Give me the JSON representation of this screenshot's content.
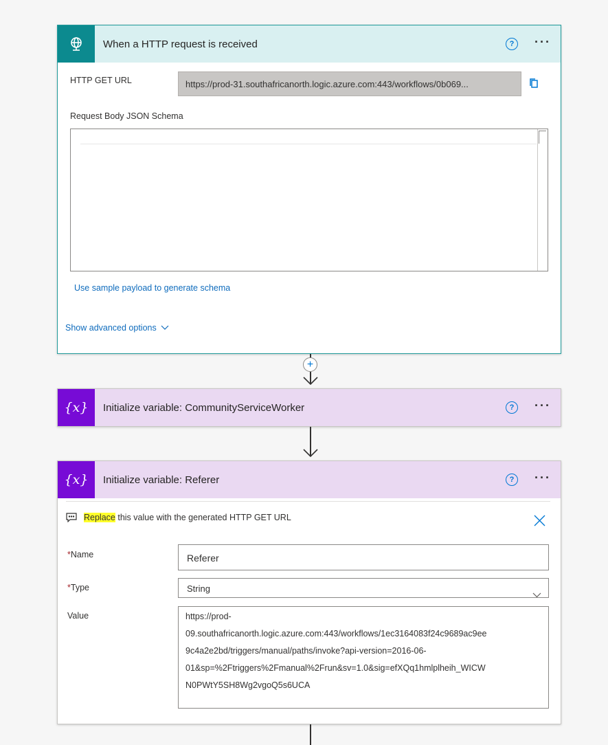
{
  "trigger": {
    "title": "When a HTTP request is received",
    "help": "?",
    "more": "···",
    "get_url_label": "HTTP GET URL",
    "get_url_value": "https://prod-31.southafricanorth.logic.azure.com:443/workflows/0b069...",
    "schema_label": "Request Body JSON Schema",
    "sample_payload_link": "Use sample payload to generate schema",
    "advanced_options_link": "Show advanced options"
  },
  "add_step": {
    "label": "+"
  },
  "var1": {
    "title": "Initialize variable: CommunityServiceWorker",
    "help": "?",
    "more": "···"
  },
  "var2": {
    "title": "Initialize variable: Referer",
    "help": "?",
    "more": "···",
    "hint_highlight": "Replace",
    "hint_rest": " this value with the generated HTTP GET URL",
    "name_label": "Name",
    "name_value": "Referer",
    "type_label": "Type",
    "type_value": "String",
    "value_label": "Value",
    "required_mark": "*",
    "value_lines": [
      "https://prod-",
      "09.southafricanorth.logic.azure.com:443/workflows/1ec3164083f24c9689ac9ee",
      "9c4a2e2bd/triggers/manual/paths/invoke?api-version=2016-06-",
      "01&sp=%2Ftriggers%2Fmanual%2Frun&sv=1.0&sig=efXQq1hmlplheih_WICW",
      "N0PWtY5SH8Wg2vgoQ5s6UCA"
    ]
  },
  "colors": {
    "trigger_accent": "#0c8a8f",
    "trigger_header_bg": "#d9f0f1",
    "variable_accent": "#770bd6",
    "variable_header_bg": "#ead9f2",
    "link": "#0f6cbd",
    "highlight": "#ffff2a"
  },
  "icons": {
    "trigger_icon": "globe-request-icon",
    "variable_icon": "variable-x-icon",
    "copy_icon": "copy-icon",
    "help_icon": "help-circle-icon",
    "more_icon": "ellipsis-icon",
    "close_icon": "close-icon",
    "chevron_icon": "chevron-down-icon",
    "comment_icon": "comment-icon"
  }
}
